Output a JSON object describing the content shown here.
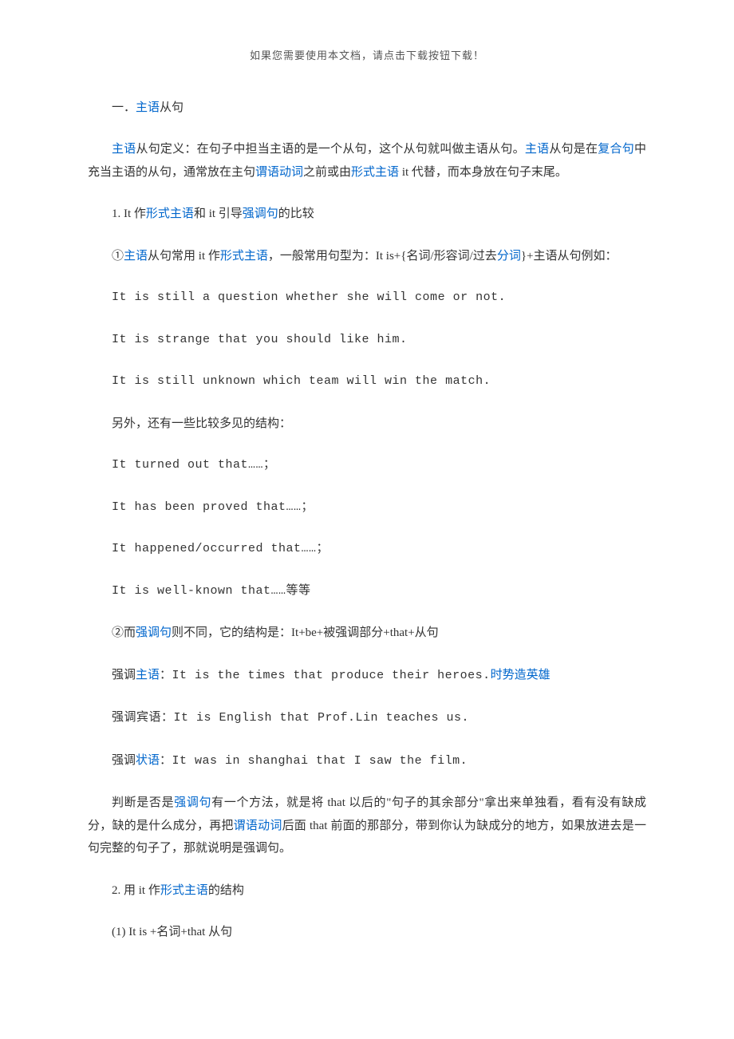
{
  "header_note": "如果您需要使用本文档，请点击下载按钮下载！",
  "section_title": {
    "prefix": "一．",
    "link": "主语",
    "suffix": "从句"
  },
  "def_para": {
    "t1": "主语",
    "t2": "从句定义：在句子中担当主语的是一个从句，这个从句就叫做主语从句。",
    "t3": "主语",
    "t4": "从句是在",
    "t5": "复合句",
    "t6": "中充当主语的从句，通常放在主句",
    "t7": "谓语动词",
    "t8": "之前或由",
    "t9": "形式主语",
    "t10": " it 代替，而本身放在句子末尾。"
  },
  "sec1_title": {
    "t1": "1. It 作",
    "t2": "形式主语",
    "t3": "和 it 引导",
    "t4": "强调句",
    "t5": "的比较"
  },
  "p1": {
    "t1": "①",
    "t2": "主语",
    "t3": "从句常用 it 作",
    "t4": "形式主语",
    "t5": "，一般常用句型为：It is+{名词/形容词/过去",
    "t6": "分词",
    "t7": "}+主语从句例如："
  },
  "ex1": "It is still a question whether she will come or not.",
  "ex2": "It is strange that you should like him.",
  "ex3": "It is still unknown which team will win the match.",
  "p2": "另外，还有一些比较多见的结构：",
  "ex4": "It turned out that……；",
  "ex5": "It has been proved that……；",
  "ex6": "It happened/occurred that……；",
  "ex7": "It is well-known that……等等",
  "p3": {
    "t1": "②而",
    "t2": "强调句",
    "t3": "则不同，它的结构是：It+be+被强调部分+that+从句"
  },
  "p4": {
    "t1": "强调",
    "t2": "主语",
    "t3": "：It is the times that produce their heroes.",
    "t4": "时势造英雄"
  },
  "p5": "强调宾语：It is English that Prof.Lin teaches us.",
  "p6": {
    "t1": "强调",
    "t2": "状语",
    "t3": "：It was in shanghai that I saw the film."
  },
  "p7": {
    "t1": "判断是否是",
    "t2": "强调句",
    "t3": "有一个方法，就是将 that 以后的\"句子的其余部分\"拿出来单独看，看有没有缺成分，缺的是什么成分，再把",
    "t4": "谓语动词",
    "t5": "后面 that 前面的那部分，带到你认为缺成分的地方，如果放进去是一句完整的句子了，那就说明是强调句。"
  },
  "sec2_title": {
    "t1": "2. 用 it 作",
    "t2": "形式主语",
    "t3": "的结构"
  },
  "p8": "(1) It is +名词+that 从句"
}
